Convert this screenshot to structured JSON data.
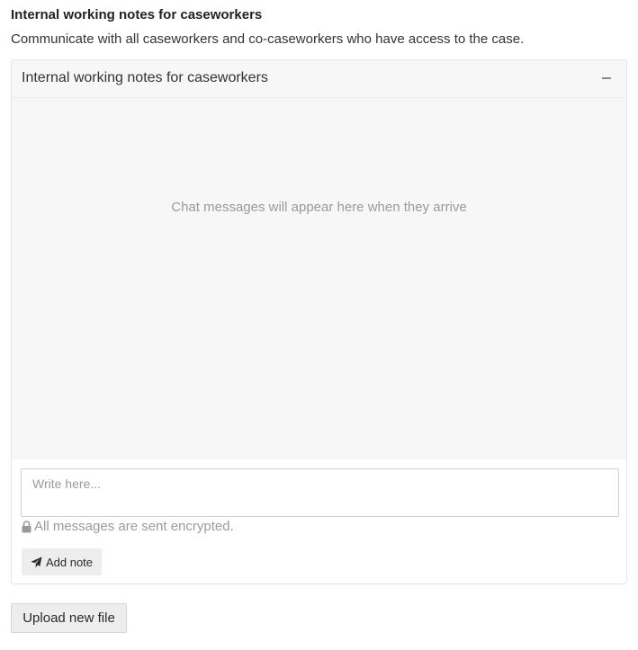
{
  "section": {
    "title": "Internal working notes for caseworkers",
    "description": "Communicate with all caseworkers and co-caseworkers who have access to the case."
  },
  "panel": {
    "title": "Internal working notes for caseworkers",
    "collapse_icon": "minus-icon",
    "empty_message": "Chat messages will appear here when they arrive",
    "compose": {
      "placeholder": "Write here...",
      "value": ""
    },
    "encryption_icon": "lock-icon",
    "encryption_note": "All messages are sent encrypted.",
    "add_note_icon": "paper-plane-icon",
    "add_note_label": "Add note"
  },
  "upload": {
    "label": "Upload new file"
  },
  "colors": {
    "panel_background": "#f7f7f7",
    "button_background": "#ededed",
    "muted_text": "#9a9a9a"
  }
}
